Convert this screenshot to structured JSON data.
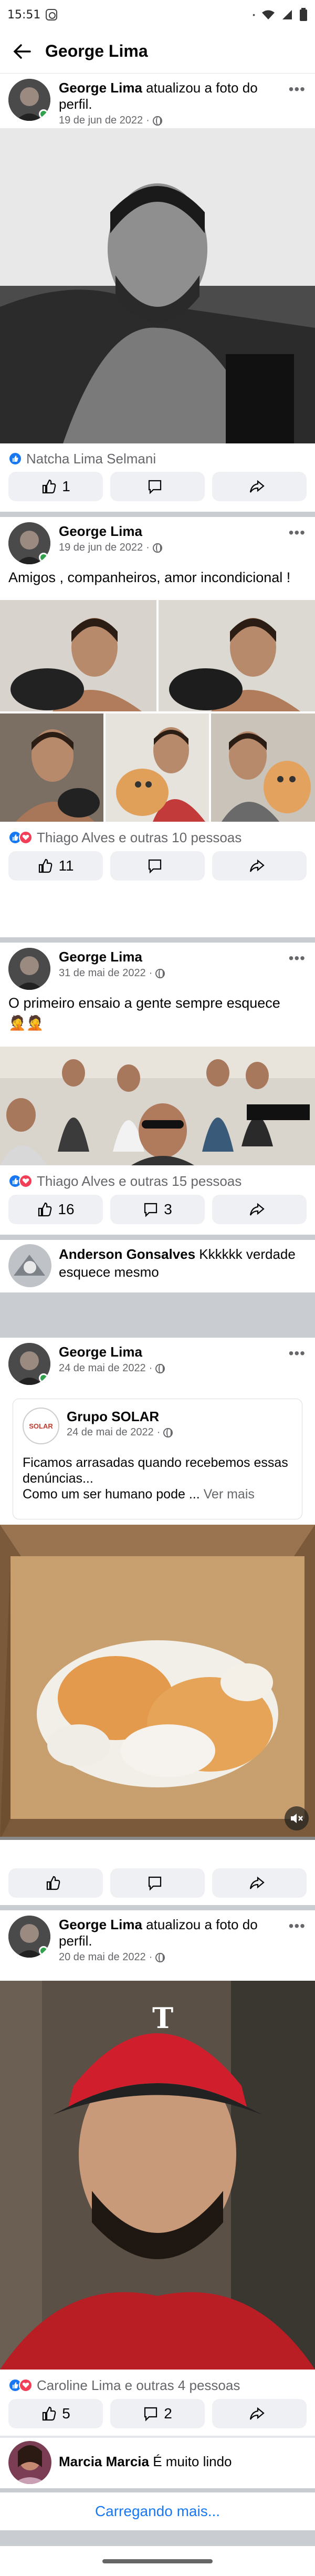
{
  "status_bar": {
    "time": "15:51"
  },
  "app_bar": {
    "title": "George Lima"
  },
  "posts": [
    {
      "author": "George Lima",
      "action": " atualizou a foto do perfil.",
      "date": "19 de jun de 2022",
      "reactions_text": "Natcha Lima Selmani",
      "like_count": "1",
      "comment_count": "",
      "share_count": ""
    },
    {
      "author": "George Lima",
      "action": "",
      "date": "19 de jun de 2022",
      "text": "Amigos , companheiros, amor incondicional !",
      "reactions_text": "Thiago Alves e outras 10 pessoas",
      "like_count": "11",
      "comment_count": "",
      "share_count": ""
    },
    {
      "author": "George Lima",
      "action": "",
      "date": "31 de mai de 2022",
      "text": "O primeiro ensaio a gente sempre esquece",
      "emoji": "🤦🤦",
      "reactions_text": "Thiago Alves e outras 15 pessoas",
      "like_count": "16",
      "comment_count": "3",
      "share_count": "",
      "comment": {
        "author": "Anderson Gonsalves",
        "text": " Kkkkkk verdade esquece mesmo"
      }
    },
    {
      "author": "George Lima",
      "action": "",
      "date": "24 de mai de 2022",
      "shared": {
        "page": "Grupo SOLAR",
        "date": "24 de mai de 2022",
        "text": "Ficamos arrasadas quando recebemos essas denúncias...",
        "text2": "Como um ser humano pode ...",
        "more": "Ver mais",
        "logo_text": "SOLAR"
      },
      "like_count": "",
      "comment_count": "",
      "share_count": ""
    },
    {
      "author": "George Lima",
      "action": " atualizou a foto do perfil.",
      "date": "20 de mai de 2022",
      "reactions_text": "Caroline Lima e outras 4 pessoas",
      "like_count": "5",
      "comment_count": "2",
      "share_count": "",
      "comment": {
        "author": "Marcia Marcia",
        "text": " É muito lindo"
      }
    }
  ],
  "loading_text": "Carregando mais...",
  "colors": {
    "accent": "#1877f2",
    "like": "#1877f2",
    "love": "#f33e58",
    "online": "#31a24c"
  }
}
